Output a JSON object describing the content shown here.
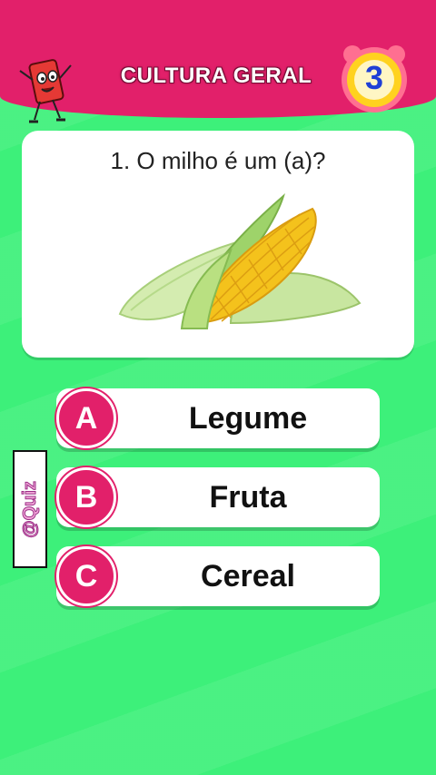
{
  "header": {
    "title": "CULTURA GERAL",
    "timer_value": "3"
  },
  "question": {
    "text": "1. O milho é um (a)?",
    "image": "corn-image"
  },
  "options": [
    {
      "letter": "A",
      "label": "Legume"
    },
    {
      "letter": "B",
      "label": "Fruta"
    },
    {
      "letter": "C",
      "label": "Cereal"
    }
  ],
  "watermark": "@Quiz",
  "colors": {
    "accent": "#e2206a",
    "background": "#3df07a",
    "timer_ring": "#ffd21f",
    "timer_number": "#1f3fd6"
  }
}
